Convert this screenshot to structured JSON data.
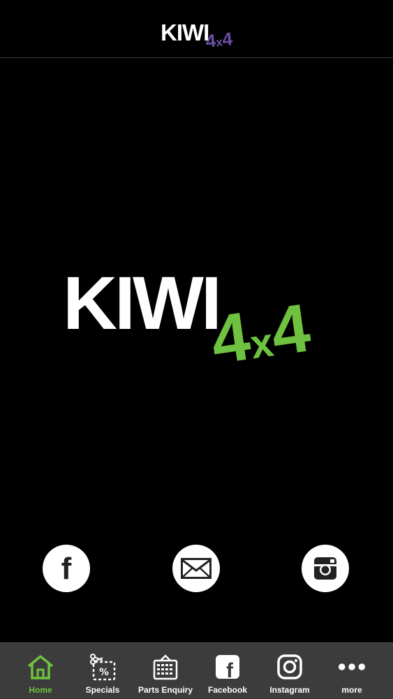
{
  "header": {
    "logo_text_main": "KIWI",
    "logo_text_num1": "4",
    "logo_text_x": "x",
    "logo_text_num2": "4"
  },
  "hero": {
    "logo_text_main": "KIWI",
    "logo_text_num1": "4",
    "logo_text_x": "x",
    "logo_text_num2": "4"
  },
  "social": [
    {
      "icon": "facebook-icon"
    },
    {
      "icon": "mail-icon"
    },
    {
      "icon": "instagram-icon"
    }
  ],
  "tabs": [
    {
      "label": "Home",
      "icon": "home-icon",
      "active": true
    },
    {
      "label": "Specials",
      "icon": "coupon-icon",
      "active": false
    },
    {
      "label": "Parts Enquiry",
      "icon": "form-icon",
      "active": false
    },
    {
      "label": "Facebook",
      "icon": "facebook-icon",
      "active": false
    },
    {
      "label": "Instagram",
      "icon": "instagram-icon",
      "active": false
    },
    {
      "label": "more",
      "icon": "more-icon",
      "active": false
    }
  ],
  "colors": {
    "background": "#000000",
    "tabbar": "#3c3c3c",
    "accent_green": "#6fc23f",
    "header_logo_purple": "#6b4fa6"
  }
}
